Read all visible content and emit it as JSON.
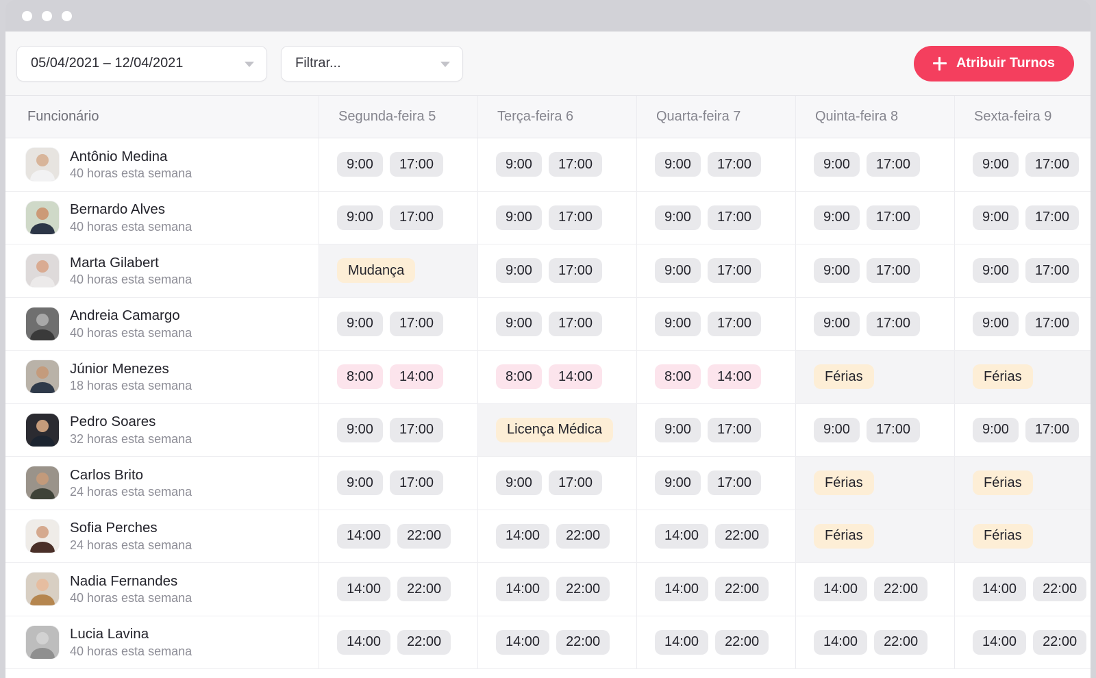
{
  "window": {
    "controls": [
      "close-dot",
      "minimize-dot",
      "maximize-dot"
    ]
  },
  "toolbar": {
    "date_range": "05/04/2021 – 12/04/2021",
    "filter_placeholder": "Filtrar...",
    "assign_label": "Atribuir Turnos",
    "accent_color": "#f43f5e"
  },
  "table": {
    "employee_header": "Funcionário",
    "day_headers": [
      "Segunda-feira 5",
      "Terça-feira 6",
      "Quarta-feira 7",
      "Quinta-feira 8",
      "Sexta-feira 9"
    ],
    "hours_suffix": "horas esta semana",
    "colors": {
      "shift_pill": "#e9e9ec",
      "early_shift_pill": "#fce4ec",
      "absence_pill": "#fdeed6",
      "absence_cell_bg": "#f4f4f6"
    },
    "rows": [
      {
        "name": "Antônio Medina",
        "hours": "40 horas esta semana",
        "avatar": "avatar-antonio",
        "days": [
          {
            "type": "shift",
            "start": "9:00",
            "end": "17:00",
            "style": "gray"
          },
          {
            "type": "shift",
            "start": "9:00",
            "end": "17:00",
            "style": "gray"
          },
          {
            "type": "shift",
            "start": "9:00",
            "end": "17:00",
            "style": "gray"
          },
          {
            "type": "shift",
            "start": "9:00",
            "end": "17:00",
            "style": "gray"
          },
          {
            "type": "shift",
            "start": "9:00",
            "end": "17:00",
            "style": "gray"
          }
        ]
      },
      {
        "name": "Bernardo Alves",
        "hours": "40 horas esta semana",
        "avatar": "avatar-bernardo",
        "days": [
          {
            "type": "shift",
            "start": "9:00",
            "end": "17:00",
            "style": "gray"
          },
          {
            "type": "shift",
            "start": "9:00",
            "end": "17:00",
            "style": "gray"
          },
          {
            "type": "shift",
            "start": "9:00",
            "end": "17:00",
            "style": "gray"
          },
          {
            "type": "shift",
            "start": "9:00",
            "end": "17:00",
            "style": "gray"
          },
          {
            "type": "shift",
            "start": "9:00",
            "end": "17:00",
            "style": "gray"
          }
        ]
      },
      {
        "name": "Marta Gilabert",
        "hours": "40 horas esta semana",
        "avatar": "avatar-marta",
        "days": [
          {
            "type": "absence",
            "label": "Mudança"
          },
          {
            "type": "shift",
            "start": "9:00",
            "end": "17:00",
            "style": "gray"
          },
          {
            "type": "shift",
            "start": "9:00",
            "end": "17:00",
            "style": "gray"
          },
          {
            "type": "shift",
            "start": "9:00",
            "end": "17:00",
            "style": "gray"
          },
          {
            "type": "shift",
            "start": "9:00",
            "end": "17:00",
            "style": "gray"
          }
        ]
      },
      {
        "name": "Andreia Camargo",
        "hours": "40 horas esta semana",
        "avatar": "avatar-andreia",
        "days": [
          {
            "type": "shift",
            "start": "9:00",
            "end": "17:00",
            "style": "gray"
          },
          {
            "type": "shift",
            "start": "9:00",
            "end": "17:00",
            "style": "gray"
          },
          {
            "type": "shift",
            "start": "9:00",
            "end": "17:00",
            "style": "gray"
          },
          {
            "type": "shift",
            "start": "9:00",
            "end": "17:00",
            "style": "gray"
          },
          {
            "type": "shift",
            "start": "9:00",
            "end": "17:00",
            "style": "gray"
          }
        ]
      },
      {
        "name": "Júnior Menezes",
        "hours": "18 horas esta semana",
        "avatar": "avatar-junior",
        "days": [
          {
            "type": "shift",
            "start": "8:00",
            "end": "14:00",
            "style": "pink"
          },
          {
            "type": "shift",
            "start": "8:00",
            "end": "14:00",
            "style": "pink"
          },
          {
            "type": "shift",
            "start": "8:00",
            "end": "14:00",
            "style": "pink"
          },
          {
            "type": "absence",
            "label": "Férias"
          },
          {
            "type": "absence",
            "label": "Férias"
          }
        ]
      },
      {
        "name": "Pedro Soares",
        "hours": "32 horas esta semana",
        "avatar": "avatar-pedro",
        "days": [
          {
            "type": "shift",
            "start": "9:00",
            "end": "17:00",
            "style": "gray"
          },
          {
            "type": "absence",
            "label": "Licença Médica"
          },
          {
            "type": "shift",
            "start": "9:00",
            "end": "17:00",
            "style": "gray"
          },
          {
            "type": "shift",
            "start": "9:00",
            "end": "17:00",
            "style": "gray"
          },
          {
            "type": "shift",
            "start": "9:00",
            "end": "17:00",
            "style": "gray"
          }
        ]
      },
      {
        "name": "Carlos Brito",
        "hours": "24 horas esta semana",
        "avatar": "avatar-carlos",
        "days": [
          {
            "type": "shift",
            "start": "9:00",
            "end": "17:00",
            "style": "gray"
          },
          {
            "type": "shift",
            "start": "9:00",
            "end": "17:00",
            "style": "gray"
          },
          {
            "type": "shift",
            "start": "9:00",
            "end": "17:00",
            "style": "gray"
          },
          {
            "type": "absence",
            "label": "Férias"
          },
          {
            "type": "absence",
            "label": "Férias"
          }
        ]
      },
      {
        "name": "Sofia Perches",
        "hours": "24 horas esta semana",
        "avatar": "avatar-sofia",
        "days": [
          {
            "type": "shift",
            "start": "14:00",
            "end": "22:00",
            "style": "gray"
          },
          {
            "type": "shift",
            "start": "14:00",
            "end": "22:00",
            "style": "gray"
          },
          {
            "type": "shift",
            "start": "14:00",
            "end": "22:00",
            "style": "gray"
          },
          {
            "type": "absence",
            "label": "Férias"
          },
          {
            "type": "absence",
            "label": "Férias"
          }
        ]
      },
      {
        "name": "Nadia Fernandes",
        "hours": "40 horas esta semana",
        "avatar": "avatar-nadia",
        "days": [
          {
            "type": "shift",
            "start": "14:00",
            "end": "22:00",
            "style": "gray"
          },
          {
            "type": "shift",
            "start": "14:00",
            "end": "22:00",
            "style": "gray"
          },
          {
            "type": "shift",
            "start": "14:00",
            "end": "22:00",
            "style": "gray"
          },
          {
            "type": "shift",
            "start": "14:00",
            "end": "22:00",
            "style": "gray"
          },
          {
            "type": "shift",
            "start": "14:00",
            "end": "22:00",
            "style": "gray"
          }
        ]
      },
      {
        "name": "Lucia Lavina",
        "hours": "40 horas esta semana",
        "avatar": "avatar-lucia",
        "days": [
          {
            "type": "shift",
            "start": "14:00",
            "end": "22:00",
            "style": "gray"
          },
          {
            "type": "shift",
            "start": "14:00",
            "end": "22:00",
            "style": "gray"
          },
          {
            "type": "shift",
            "start": "14:00",
            "end": "22:00",
            "style": "gray"
          },
          {
            "type": "shift",
            "start": "14:00",
            "end": "22:00",
            "style": "gray"
          },
          {
            "type": "shift",
            "start": "14:00",
            "end": "22:00",
            "style": "gray"
          }
        ]
      }
    ]
  }
}
